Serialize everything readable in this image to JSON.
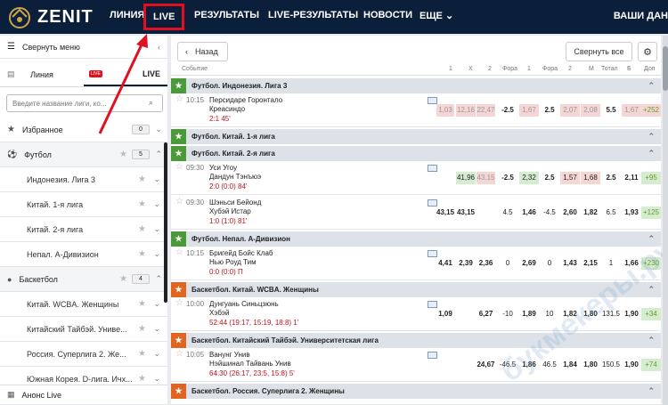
{
  "top": {
    "brand": "ZENIT",
    "nav": [
      "ЛИНИЯ",
      "LIVE",
      "РЕЗУЛЬТАТЫ",
      "LIVE-РЕЗУЛЬТАТЫ",
      "НОВОСТИ",
      "ЕЩЕ"
    ],
    "user": "ВАШИ ДАН"
  },
  "sidebar": {
    "collapse": "Свернуть меню",
    "tab_line": "Линия",
    "tab_live": "LIVE",
    "search_placeholder": "Введите название лиги, ко...",
    "fav": {
      "label": "Избранное",
      "count": "0"
    },
    "football": {
      "label": "Футбол",
      "count": "5"
    },
    "football_items": [
      "Индонезия. Лига 3",
      "Китай. 1-я лига",
      "Китай. 2-я лига",
      "Непал. А-Дивизион"
    ],
    "basketball": {
      "label": "Баскетбол",
      "count": "4"
    },
    "basketball_items": [
      "Китай. WCBA. Женщины",
      "Китайский Тайбэй. Униве...",
      "Россия. Суперлига 2. Же...",
      "Южная Корея. D-лига. Ичх..."
    ],
    "anons": "Анонс Live"
  },
  "main": {
    "back": "Назад",
    "collapse_all": "Свернуть все",
    "headers": [
      "Событие",
      "1",
      "X",
      "2",
      "Фора",
      "1",
      "Фора",
      "2",
      "М",
      "Тотал",
      "Б",
      "Доп"
    ],
    "leagues": [
      "Футбол. Индонезия. Лига 3",
      "Футбол. Китай. 1-я лига",
      "Футбол. Китай. 2-я лига",
      "Футбол. Непал. А-Дивизион",
      "Баскетбол. Китай. WCBA. Женщины",
      "Баскетбол. Китайский Тайбэй. Университетская лига",
      "Баскетбол. Россия. Суперлига 2. Женщины"
    ],
    "matches": [
      {
        "time": "10:15",
        "home": "Персидаре Горонтало",
        "away": "Креасиндо",
        "score": "2:1 45'",
        "odds": [
          "1,03",
          "12,16",
          "22,47",
          "-2.5",
          "1,67",
          "2.5",
          "2,07",
          "2,08",
          "5.5",
          "1,67",
          "+252"
        ]
      },
      {
        "time": "09:30",
        "home": "Уси Угоу",
        "away": "Дандун Тэнъюэ",
        "score": "2:0 (0:0) 84'",
        "odds": [
          "",
          "41,96",
          "43,15",
          "-2.5",
          "2,32",
          "2.5",
          "1,57",
          "1,68",
          "2.5",
          "2,11",
          "+95"
        ]
      },
      {
        "time": "09:30",
        "home": "Шэньси Бейонд",
        "away": "Хубэй Истар",
        "score": "1:0 (1:0) 81'",
        "odds": [
          "43,15",
          "43,15",
          "",
          "4.5",
          "1,46",
          "-4.5",
          "2,60",
          "1,82",
          "6.5",
          "1,93",
          "+125"
        ]
      },
      {
        "time": "10:15",
        "home": "Бригейд Бойс Клаб",
        "away": "Нью Роуд Тим",
        "score": "0:0 (0:0) П",
        "odds": [
          "4,41",
          "2,39",
          "2,36",
          "0",
          "2,69",
          "0",
          "1,43",
          "2,15",
          "1",
          "1,66",
          "+230"
        ]
      },
      {
        "time": "10:00",
        "home": "Дунгуань Синьцзюнь",
        "away": "Хэбэй",
        "score": "52:44 (19:17, 15:19, 18:8) 1'",
        "odds": [
          "1,09",
          "",
          "6,27",
          "-10",
          "1,89",
          "10",
          "1,82",
          "1,80",
          "131.5",
          "1,90",
          "+34"
        ]
      },
      {
        "time": "10:05",
        "home": "Ванунг Унив",
        "away": "Нэйшинал Тайвань Унив",
        "score": "64:30 (26:17, 23:5, 15:8) 5'",
        "odds": [
          "",
          "",
          "24,67",
          "-46.5",
          "1,86",
          "46.5",
          "1,84",
          "1,80",
          "150.5",
          "1,90",
          "+74"
        ]
      }
    ]
  },
  "watermark": "букмекеры.ру",
  "colors": {
    "topbar": "#0c1f3a",
    "accent_red": "#e01020",
    "score_red": "#c0131d",
    "football_green": "#4a9a3a",
    "basket_orange": "#e0651e"
  }
}
